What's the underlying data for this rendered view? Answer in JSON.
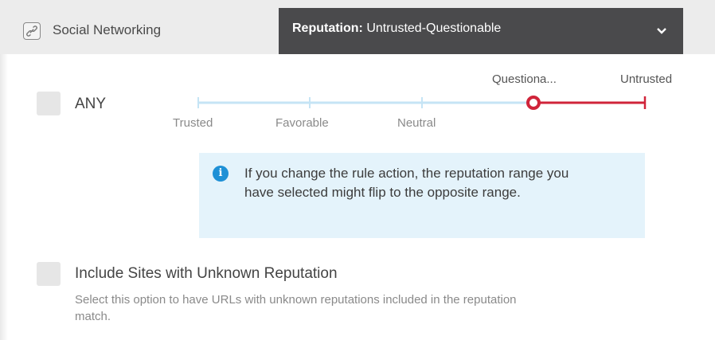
{
  "header": {
    "category": {
      "label": "Social Networking",
      "icon": "link-icon"
    },
    "reputation_dropdown": {
      "prefix": "Reputation:",
      "value": "Untrusted-Questionable",
      "icon": "chevron-down-icon"
    }
  },
  "any_option": {
    "label": "ANY",
    "checked": false
  },
  "reputation_scale": {
    "levels": [
      {
        "label": "Trusted"
      },
      {
        "label": "Favorable"
      },
      {
        "label": "Neutral"
      },
      {
        "label": "Questiona..."
      },
      {
        "label": "Untrusted"
      }
    ],
    "selected_range": [
      "Questiona...",
      "Untrusted"
    ],
    "colors": {
      "track": "#c5e4f5",
      "selected": "#d0243a"
    }
  },
  "info": {
    "icon": "info-icon",
    "text": "If you change the rule action, the reputation range you have selected might flip to the opposite range."
  },
  "unknown_option": {
    "label": "Include Sites with Unknown Reputation",
    "description": "Select this option to have URLs with unknown reputations included in the reputation match.",
    "checked": false
  }
}
